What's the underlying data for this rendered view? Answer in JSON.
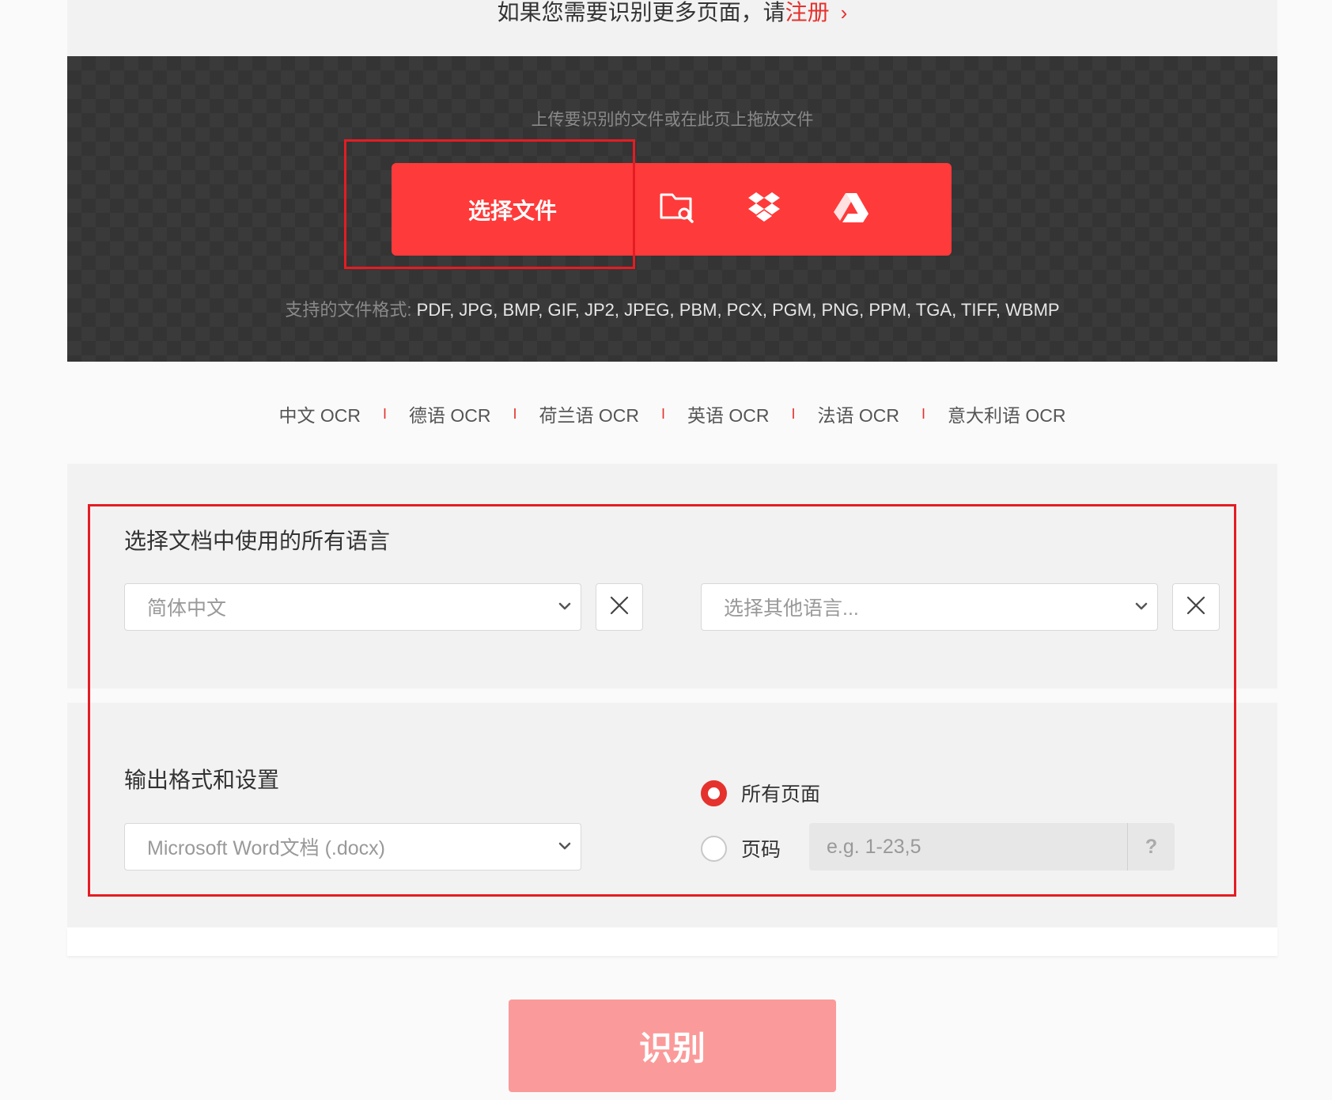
{
  "banner": {
    "message": "如果您需要识别更多页面，请",
    "link": "注册",
    "chevron": "›"
  },
  "upload": {
    "hint": "上传要识别的文件或在此页上拖放文件",
    "choose_label": "选择文件",
    "icons": [
      "folder-search-icon",
      "dropbox-icon",
      "google-drive-icon"
    ],
    "formats_label": "支持的文件格式: ",
    "formats_value": "PDF, JPG, BMP, GIF, JP2, JPEG, PBM, PCX, PGM, PNG, PPM, TGA, TIFF, WBMP"
  },
  "lang_links": {
    "separator": "I",
    "items": [
      "中文 OCR",
      "德语 OCR",
      "荷兰语 OCR",
      "英语 OCR",
      "法语 OCR",
      "意大利语 OCR"
    ]
  },
  "languages": {
    "title": "选择文档中使用的所有语言",
    "primary_value": "简体中文",
    "secondary_placeholder": "选择其他语言..."
  },
  "output": {
    "title": "输出格式和设置",
    "format_value": "Microsoft Word文档 (.docx)",
    "all_pages_label": "所有页面",
    "page_range_label": "页码",
    "page_range_placeholder": "e.g. 1-23,5",
    "help": "?",
    "selected_option": "所有页面"
  },
  "recognize_label": "识别",
  "colors": {
    "accent": "#e5322d",
    "button_red": "#ff3a3a",
    "recognize_disabled": "#fb9a9a",
    "annotation_box": "#e51c23"
  }
}
